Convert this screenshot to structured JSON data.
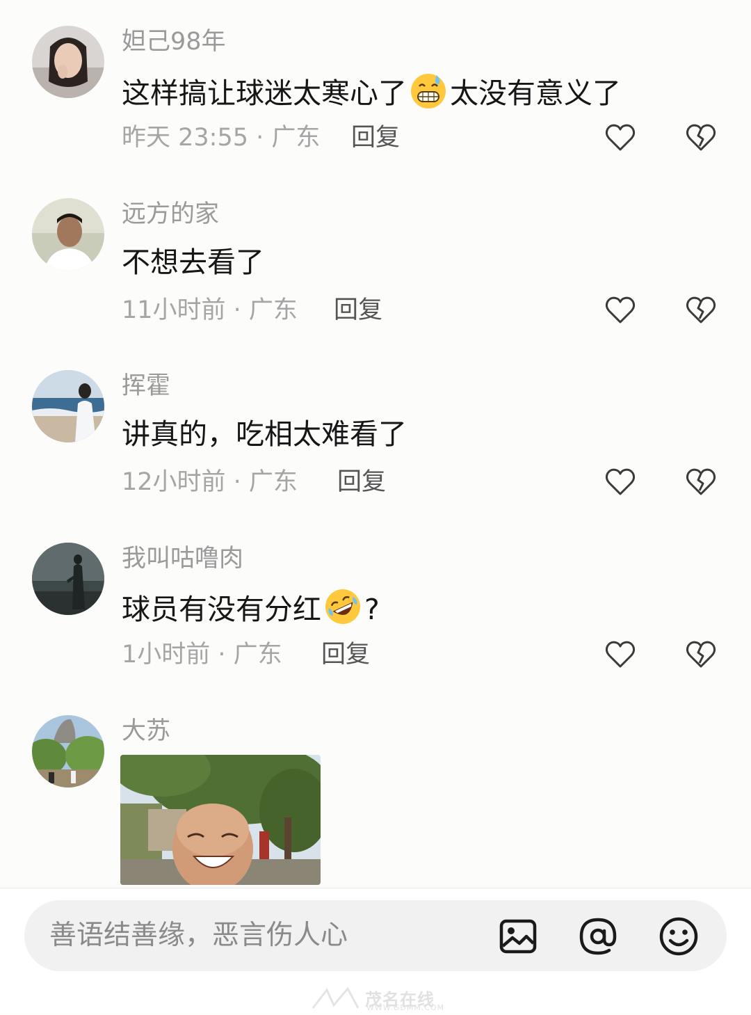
{
  "comments": [
    {
      "username": "妲己98年",
      "text_before": "这样搞让球迷太寒心了",
      "emoji": "grimacing-sweat-emoji",
      "text_after": "太没有意义了",
      "meta": "昨天 23:55 · 广东",
      "reply_label": "回复"
    },
    {
      "username": "远方的家",
      "text": "不想去看了",
      "meta": "11小时前 · 广东",
      "reply_label": "回复"
    },
    {
      "username": "挥霍",
      "text": "讲真的，吃相太难看了",
      "meta": "12小时前 · 广东",
      "reply_label": "回复"
    },
    {
      "username": "我叫咕噜肉",
      "text_before": "球员有没有分红",
      "emoji": "rofl-emoji",
      "text_after": "?",
      "meta": "1小时前 · 广东",
      "reply_label": "回复"
    },
    {
      "username": "大苏",
      "attachment": "photo of laughing bald man under a tree"
    }
  ],
  "input": {
    "placeholder": "善语结善缘，恶言伤人心"
  },
  "toolbar": {
    "icons": [
      "image-icon",
      "at-mention-icon",
      "emoji-icon"
    ]
  },
  "watermark": {
    "text": "茂名在线",
    "sub": "WWW.GDMM.COM"
  },
  "colors": {
    "background": "#fcfcfb",
    "username": "#9a9a9a",
    "content": "#161616",
    "meta": "#a5a5a5",
    "reply": "#555555",
    "icon_stroke": "#3a3a3a",
    "input_bg": "#f1f1f1"
  }
}
